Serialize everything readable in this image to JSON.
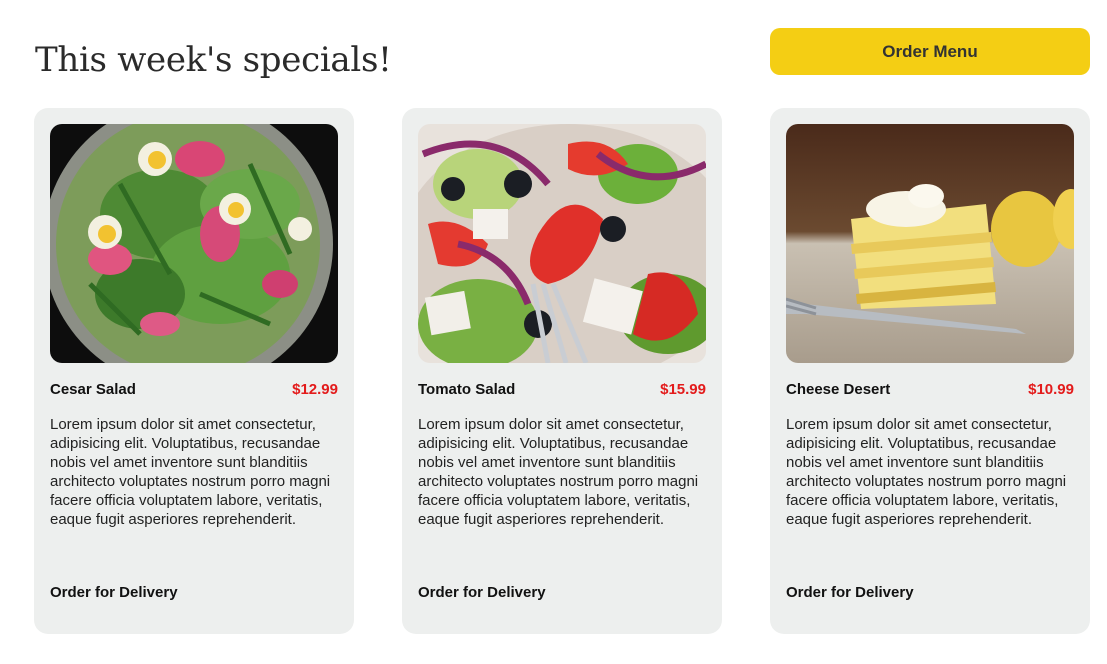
{
  "header": {
    "title": "This week's specials!",
    "order_menu_label": "Order Menu"
  },
  "colors": {
    "accent": "#f4ce14",
    "card_bg": "#edefee",
    "price": "#e31b1b"
  },
  "specials": [
    {
      "name": "Cesar Salad",
      "price": "$12.99",
      "description": "Lorem ipsum dolor sit amet consectetur, adipisicing elit. Voluptatibus, recusandae nobis vel amet inventore sunt blanditiis architecto voluptates nostrum porro magni facere officia voluptatem labore, veritatis, eaque fugit asperiores reprehenderit.",
      "link_label": "Order for Delivery",
      "image": "salad-bowl-photo"
    },
    {
      "name": "Tomato Salad",
      "price": "$15.99",
      "description": "Lorem ipsum dolor sit amet consectetur, adipisicing elit. Voluptatibus, recusandae nobis vel amet inventore sunt blanditiis architecto voluptates nostrum porro magni facere officia voluptatem labore, veritatis, eaque fugit asperiores reprehenderit.",
      "link_label": "Order for Delivery",
      "image": "tomato-salad-photo"
    },
    {
      "name": "Cheese Desert",
      "price": "$10.99",
      "description": "Lorem ipsum dolor sit amet consectetur, adipisicing elit. Voluptatibus, recusandae nobis vel amet inventore sunt blanditiis architecto voluptates nostrum porro magni facere officia voluptatem labore, veritatis, eaque fugit asperiores reprehenderit.",
      "link_label": "Order for Delivery",
      "image": "cheesecake-photo"
    }
  ]
}
